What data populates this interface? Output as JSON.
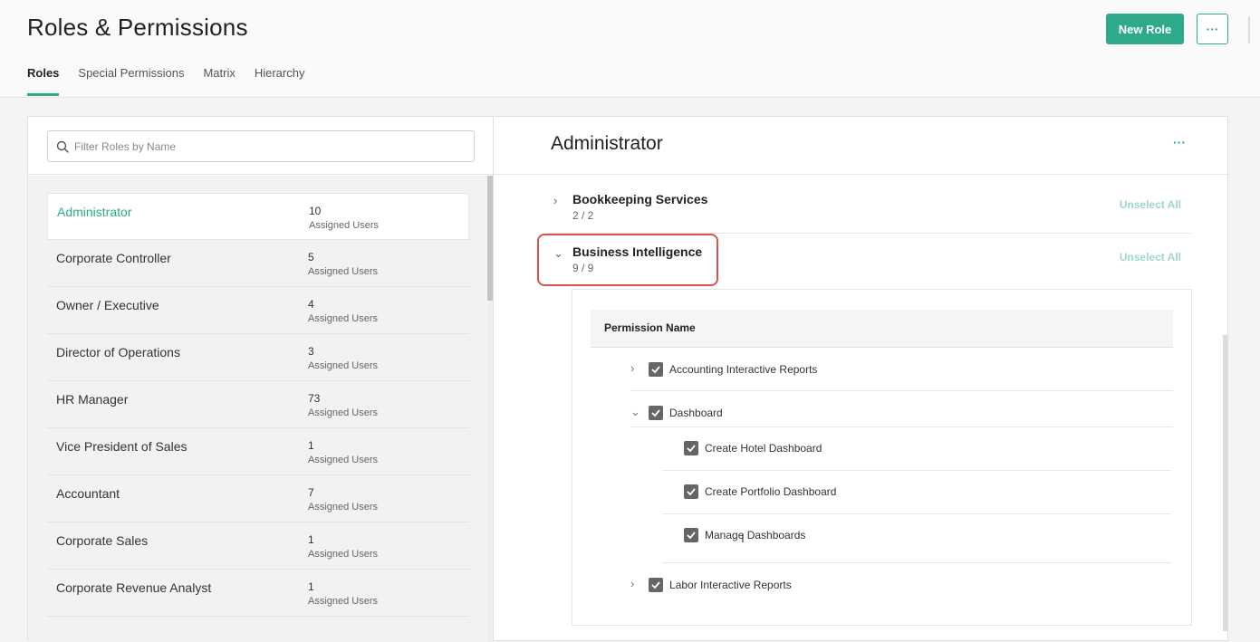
{
  "header": {
    "title": "Roles & Permissions",
    "new_role_label": "New Role",
    "more_label": "···"
  },
  "tabs": [
    {
      "label": "Roles",
      "active": true
    },
    {
      "label": "Special Permissions",
      "active": false
    },
    {
      "label": "Matrix",
      "active": false
    },
    {
      "label": "Hierarchy",
      "active": false
    }
  ],
  "search": {
    "placeholder": "Filter Roles by Name",
    "value": ""
  },
  "roles": [
    {
      "name": "Administrator",
      "count": "10",
      "sub": "Assigned Users"
    },
    {
      "name": "Corporate Controller",
      "count": "5",
      "sub": "Assigned Users"
    },
    {
      "name": "Owner / Executive",
      "count": "4",
      "sub": "Assigned Users"
    },
    {
      "name": "Director of Operations",
      "count": "3",
      "sub": "Assigned Users"
    },
    {
      "name": "HR Manager",
      "count": "73",
      "sub": "Assigned Users"
    },
    {
      "name": "Vice President of Sales",
      "count": "1",
      "sub": "Assigned Users"
    },
    {
      "name": "Accountant",
      "count": "7",
      "sub": "Assigned Users"
    },
    {
      "name": "Corporate Sales",
      "count": "1",
      "sub": "Assigned Users"
    },
    {
      "name": "Corporate Revenue Analyst",
      "count": "1",
      "sub": "Assigned Users"
    }
  ],
  "detail": {
    "title": "Administrator",
    "more_label": "···",
    "groups": [
      {
        "name": "Bookkeeping Services",
        "count": "2 / 2",
        "action": "Unselect All",
        "chevron": "›"
      },
      {
        "name": "Business Intelligence",
        "count": "9 / 9",
        "action": "Unselect All",
        "chevron": "⌄"
      }
    ],
    "permission_header": "Permission Name",
    "permissions": [
      {
        "label": "Accounting Interactive Reports",
        "chevron": "›"
      },
      {
        "label": "Dashboard",
        "chevron": "⌄"
      },
      {
        "label": "Create Hotel Dashboard",
        "chevron": ""
      },
      {
        "label": "Create Portfolio Dashboard",
        "chevron": ""
      },
      {
        "label": "Manage Dashboards",
        "chevron": ""
      },
      {
        "label": "Labor Interactive Reports",
        "chevron": "›"
      }
    ]
  },
  "colors": {
    "accent": "#2eaa8b",
    "highlight": "#d9534f"
  },
  "icons": {
    "search": "search-icon",
    "checkbox": "checkbox-checked-icon",
    "chevron": "chevron-icon"
  }
}
